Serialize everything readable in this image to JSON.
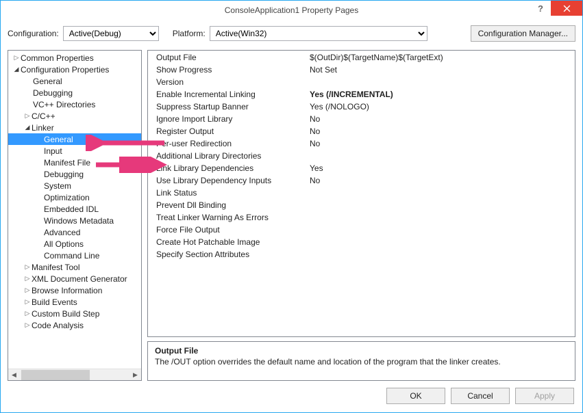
{
  "window": {
    "title": "ConsoleApplication1 Property Pages"
  },
  "config": {
    "configuration_label": "Configuration:",
    "configuration_value": "Active(Debug)",
    "platform_label": "Platform:",
    "platform_value": "Active(Win32)",
    "manager_label": "Configuration Manager..."
  },
  "tree": {
    "common": "Common Properties",
    "cfgprops": "Configuration Properties",
    "general_top": "General",
    "debugging_top": "Debugging",
    "vcdirs": "VC++ Directories",
    "ccpp": "C/C++",
    "linker": "Linker",
    "l_general": "General",
    "l_input": "Input",
    "l_manifest": "Manifest File",
    "l_debug": "Debugging",
    "l_system": "System",
    "l_opt": "Optimization",
    "l_idl": "Embedded IDL",
    "l_winmeta": "Windows Metadata",
    "l_adv": "Advanced",
    "l_allopt": "All Options",
    "l_cmdline": "Command Line",
    "manifest_tool": "Manifest Tool",
    "xmldoc": "XML Document Generator",
    "browse": "Browse Information",
    "build": "Build Events",
    "custom": "Custom Build Step",
    "codean": "Code Analysis"
  },
  "props": [
    {
      "k": "Output File",
      "v": "$(OutDir)$(TargetName)$(TargetExt)"
    },
    {
      "k": "Show Progress",
      "v": "Not Set"
    },
    {
      "k": "Version",
      "v": ""
    },
    {
      "k": "Enable Incremental Linking",
      "v": "Yes (/INCREMENTAL)",
      "bold": true
    },
    {
      "k": "Suppress Startup Banner",
      "v": "Yes (/NOLOGO)"
    },
    {
      "k": "Ignore Import Library",
      "v": "No"
    },
    {
      "k": "Register Output",
      "v": "No"
    },
    {
      "k": "Per-user Redirection",
      "v": "No"
    },
    {
      "k": "Additional Library Directories",
      "v": ""
    },
    {
      "k": "Link Library Dependencies",
      "v": "Yes"
    },
    {
      "k": "Use Library Dependency Inputs",
      "v": "No"
    },
    {
      "k": "Link Status",
      "v": ""
    },
    {
      "k": "Prevent Dll Binding",
      "v": ""
    },
    {
      "k": "Treat Linker Warning As Errors",
      "v": ""
    },
    {
      "k": "Force File Output",
      "v": ""
    },
    {
      "k": "Create Hot Patchable Image",
      "v": ""
    },
    {
      "k": "Specify Section Attributes",
      "v": ""
    }
  ],
  "description": {
    "title": "Output File",
    "text": "The /OUT option overrides the default name and location of the program that the linker creates."
  },
  "buttons": {
    "ok": "OK",
    "cancel": "Cancel",
    "apply": "Apply"
  }
}
